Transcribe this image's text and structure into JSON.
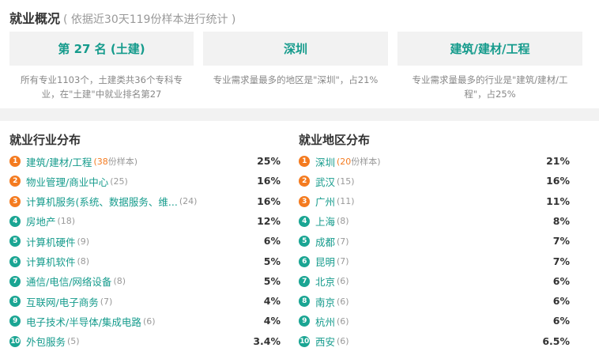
{
  "overview": {
    "title": "就业概况",
    "subtitle": "( 依据近30天119份样本进行统计 )",
    "cards": [
      {
        "label": "第 27 名 (土建)",
        "desc_line1": "所有专业1103个，土建类共36个专科专",
        "desc_line2": "业，在\"土建\"中就业排名第27"
      },
      {
        "label": "深圳",
        "desc_line1": "专业需求量最多的地区是\"深圳\"，占21%",
        "desc_line2": ""
      },
      {
        "label": "建筑/建材/工程",
        "desc_line1": "专业需求量最多的行业是\"建筑/建材/工",
        "desc_line2": "程\"，占25%"
      }
    ]
  },
  "industry": {
    "title": "就业行业分布",
    "unit_label": "份样本",
    "items": [
      {
        "rank": "1",
        "name": "建筑/建材/工程",
        "count": "(38",
        "unit": "份样本)",
        "percent": "25%"
      },
      {
        "rank": "2",
        "name": "物业管理/商业中心",
        "count": "(25)",
        "percent": "16%"
      },
      {
        "rank": "3",
        "name": "计算机服务(系统、数据服务、维...",
        "count": "(24)",
        "percent": "16%"
      },
      {
        "rank": "4",
        "name": "房地产",
        "count": "(18)",
        "percent": "12%"
      },
      {
        "rank": "5",
        "name": "计算机硬件",
        "count": "(9)",
        "percent": "6%"
      },
      {
        "rank": "6",
        "name": "计算机软件",
        "count": "(8)",
        "percent": "5%"
      },
      {
        "rank": "7",
        "name": "通信/电信/网络设备",
        "count": "(8)",
        "percent": "5%"
      },
      {
        "rank": "8",
        "name": "互联网/电子商务",
        "count": "(7)",
        "percent": "4%"
      },
      {
        "rank": "9",
        "name": "电子技术/半导体/集成电路",
        "count": "(6)",
        "percent": "4%"
      },
      {
        "rank": "10",
        "name": "外包服务",
        "count": "(5)",
        "percent": "3.4%"
      }
    ]
  },
  "region": {
    "title": "就业地区分布",
    "items": [
      {
        "rank": "1",
        "name": "深圳",
        "count": "(20",
        "unit": "份样本)",
        "percent": "21%"
      },
      {
        "rank": "2",
        "name": "武汉",
        "count": "(15)",
        "percent": "16%"
      },
      {
        "rank": "3",
        "name": "广州",
        "count": "(11)",
        "percent": "11%"
      },
      {
        "rank": "4",
        "name": "上海",
        "count": "(8)",
        "percent": "8%"
      },
      {
        "rank": "5",
        "name": "成都",
        "count": "(7)",
        "percent": "7%"
      },
      {
        "rank": "6",
        "name": "昆明",
        "count": "(7)",
        "percent": "7%"
      },
      {
        "rank": "7",
        "name": "北京",
        "count": "(6)",
        "percent": "6%"
      },
      {
        "rank": "8",
        "name": "南京",
        "count": "(6)",
        "percent": "6%"
      },
      {
        "rank": "9",
        "name": "杭州",
        "count": "(6)",
        "percent": "6%"
      },
      {
        "rank": "10",
        "name": "西安",
        "count": "(6)",
        "percent": "6.5%"
      }
    ]
  },
  "colors": {
    "accent": "#159b8c",
    "rank_top": "#f47b20",
    "rank_other": "#1aa593"
  }
}
